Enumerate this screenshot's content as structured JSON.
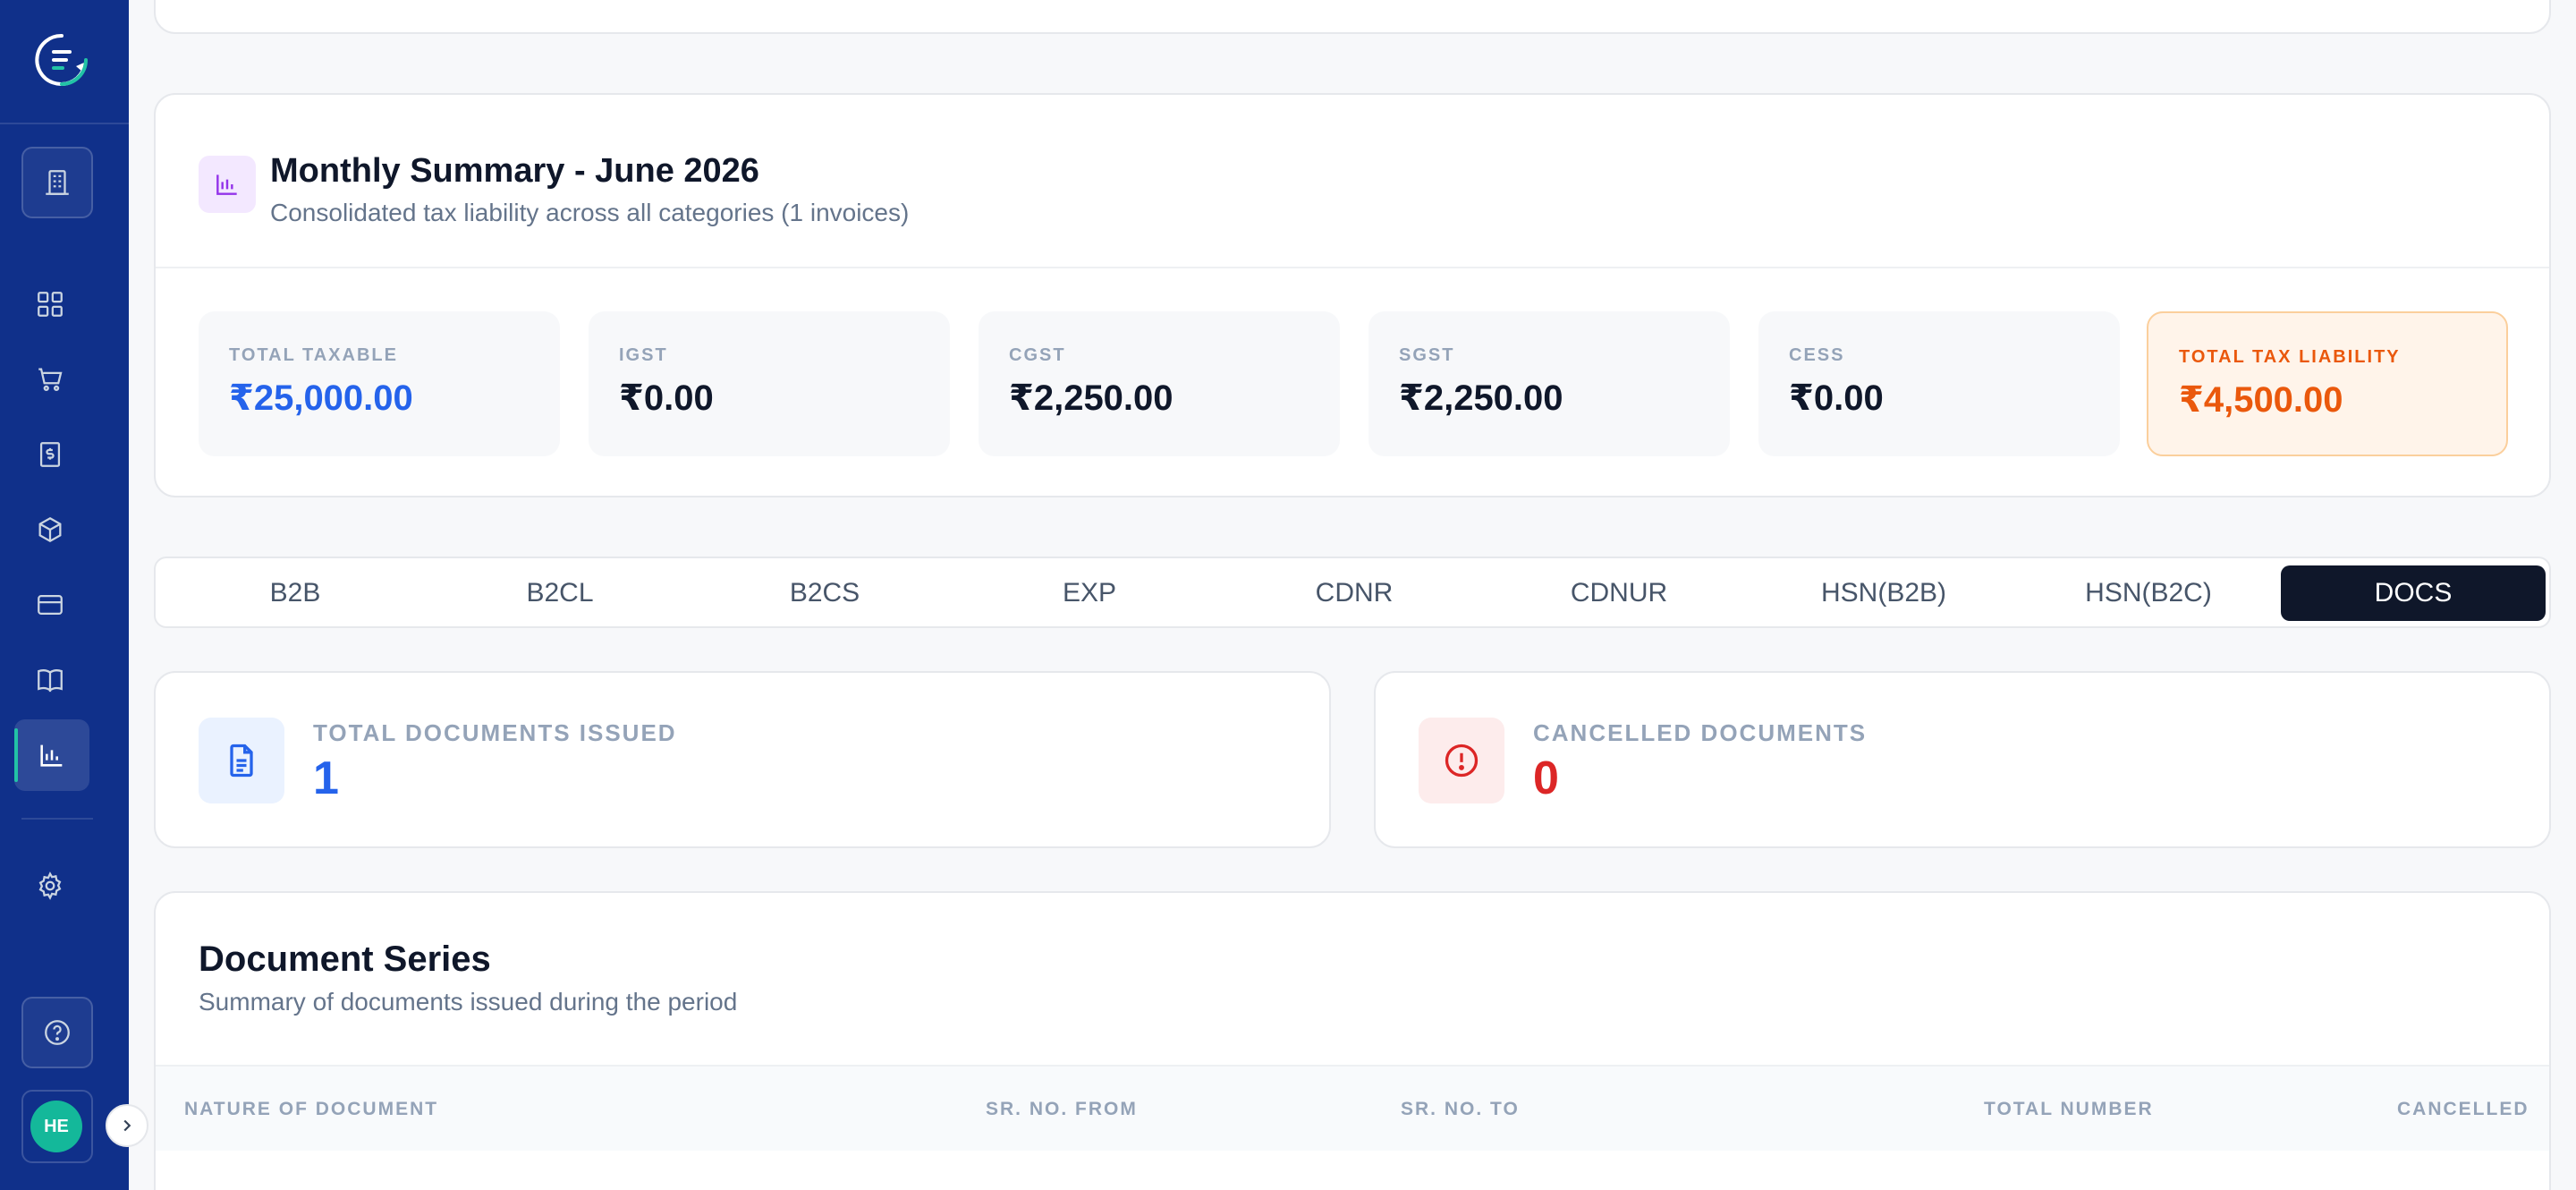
{
  "sidebar": {
    "avatar_initials": "HE",
    "accent": "#22c3a6",
    "bg": "#10308a"
  },
  "summary": {
    "title": "Monthly Summary - June 2026",
    "subtitle": "Consolidated tax liability across all categories (1 invoices)",
    "metrics": [
      {
        "label": "TOTAL TAXABLE",
        "value": "₹25,000.00"
      },
      {
        "label": "IGST",
        "value": "₹0.00"
      },
      {
        "label": "CGST",
        "value": "₹2,250.00"
      },
      {
        "label": "SGST",
        "value": "₹2,250.00"
      },
      {
        "label": "CESS",
        "value": "₹0.00"
      },
      {
        "label": "TOTAL TAX LIABILITY",
        "value": "₹4,500.00"
      }
    ]
  },
  "tabs": [
    {
      "label": "B2B"
    },
    {
      "label": "B2CL"
    },
    {
      "label": "B2CS"
    },
    {
      "label": "EXP"
    },
    {
      "label": "CDNR"
    },
    {
      "label": "CDNUR"
    },
    {
      "label": "HSN(B2B)"
    },
    {
      "label": "HSN(B2C)"
    },
    {
      "label": "DOCS"
    }
  ],
  "active_tab": "DOCS",
  "stats": {
    "issued": {
      "label": "TOTAL DOCUMENTS ISSUED",
      "value": "1"
    },
    "cancelled": {
      "label": "CANCELLED DOCUMENTS",
      "value": "0"
    }
  },
  "series": {
    "title": "Document Series",
    "subtitle": "Summary of documents issued during the period",
    "columns": [
      "NATURE OF DOCUMENT",
      "SR. NO. FROM",
      "SR. NO. TO",
      "TOTAL NUMBER",
      "CANCELLED"
    ]
  },
  "colors": {
    "blue": "#2563eb",
    "orange": "#ea580c",
    "red": "#dc2626",
    "dark": "#0f172a"
  }
}
